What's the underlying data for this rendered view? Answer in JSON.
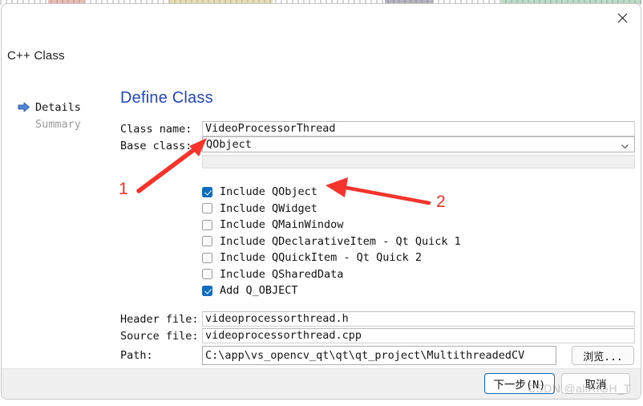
{
  "window": {
    "caption": "C++ Class",
    "close_icon": "close-icon"
  },
  "sidebar": {
    "items": [
      {
        "label": "Details",
        "state": "current",
        "icon": "right-arrow-icon"
      },
      {
        "label": "Summary",
        "state": "upcoming"
      }
    ]
  },
  "main": {
    "title": "Define Class",
    "fields": {
      "class_name": {
        "label": "Class name:",
        "value": "VideoProcessorThread"
      },
      "base_class": {
        "label": "Base class:",
        "value": "QObject",
        "icon": "chevron-down-icon"
      },
      "base_class_extra": {
        "value": ""
      },
      "header_file": {
        "label": "Header file:",
        "value": "videoprocessorthread.h"
      },
      "source_file": {
        "label": "Source file:",
        "value": "videoprocessorthread.cpp"
      },
      "path": {
        "label": "Path:",
        "value": "C:\\app\\vs_opencv_qt\\qt\\qt_project\\MultithreadedCV"
      }
    },
    "browse_label": "浏览...",
    "checkboxes": [
      {
        "label": "Include QObject",
        "checked": true
      },
      {
        "label": "Include QWidget",
        "checked": false
      },
      {
        "label": "Include QMainWindow",
        "checked": false
      },
      {
        "label": "Include QDeclarativeItem - Qt Quick 1",
        "checked": false
      },
      {
        "label": "Include QQuickItem - Qt Quick 2",
        "checked": false
      },
      {
        "label": "Include QSharedData",
        "checked": false
      },
      {
        "label": "Add Q_OBJECT",
        "checked": true
      }
    ]
  },
  "footer": {
    "next_label": "下一步(N)",
    "cancel_label": "取消"
  },
  "annotations": {
    "one": "1",
    "two": "2"
  },
  "watermark": {
    "text": "CSDN @allRIGH_T"
  },
  "colors": {
    "accent_blue": "#2346bd",
    "checkbox_blue": "#0f6cbd",
    "focus_border": "#0e6cbe",
    "annotation_red": "#f5342b",
    "muted_text": "#9b9b9b"
  }
}
